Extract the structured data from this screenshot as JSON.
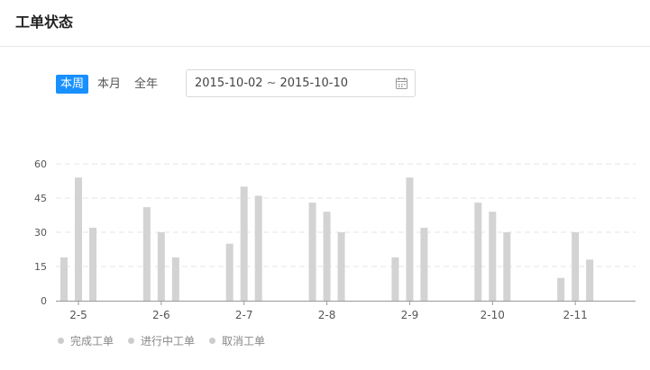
{
  "card": {
    "title": "工单状态"
  },
  "range_tabs": [
    {
      "label": "本周",
      "active": true
    },
    {
      "label": "本月",
      "active": false
    },
    {
      "label": "全年",
      "active": false
    }
  ],
  "date_picker": {
    "start": "2015-10-02",
    "separator": "~",
    "end": "2015-10-10",
    "icon": "calendar-icon"
  },
  "colors": {
    "accent": "#1890ff",
    "bar": "#d3d3d3",
    "legend_dot": "#cccccc"
  },
  "chart_data": {
    "type": "bar",
    "categories": [
      "2-5",
      "2-6",
      "2-7",
      "2-8",
      "2-9",
      "2-10",
      "2-11"
    ],
    "series": [
      {
        "name": "完成工单",
        "values": [
          19,
          41,
          25,
          43,
          19,
          43,
          10
        ]
      },
      {
        "name": "进行中工单",
        "values": [
          54,
          30,
          50,
          39,
          54,
          39,
          30
        ]
      },
      {
        "name": "取消工单",
        "values": [
          32,
          19,
          46,
          30,
          32,
          30,
          18
        ]
      }
    ],
    "yticks": [
      0,
      15,
      30,
      45,
      60
    ],
    "ylim": [
      0,
      60
    ],
    "grid": true,
    "legend_position": "bottom-left"
  }
}
